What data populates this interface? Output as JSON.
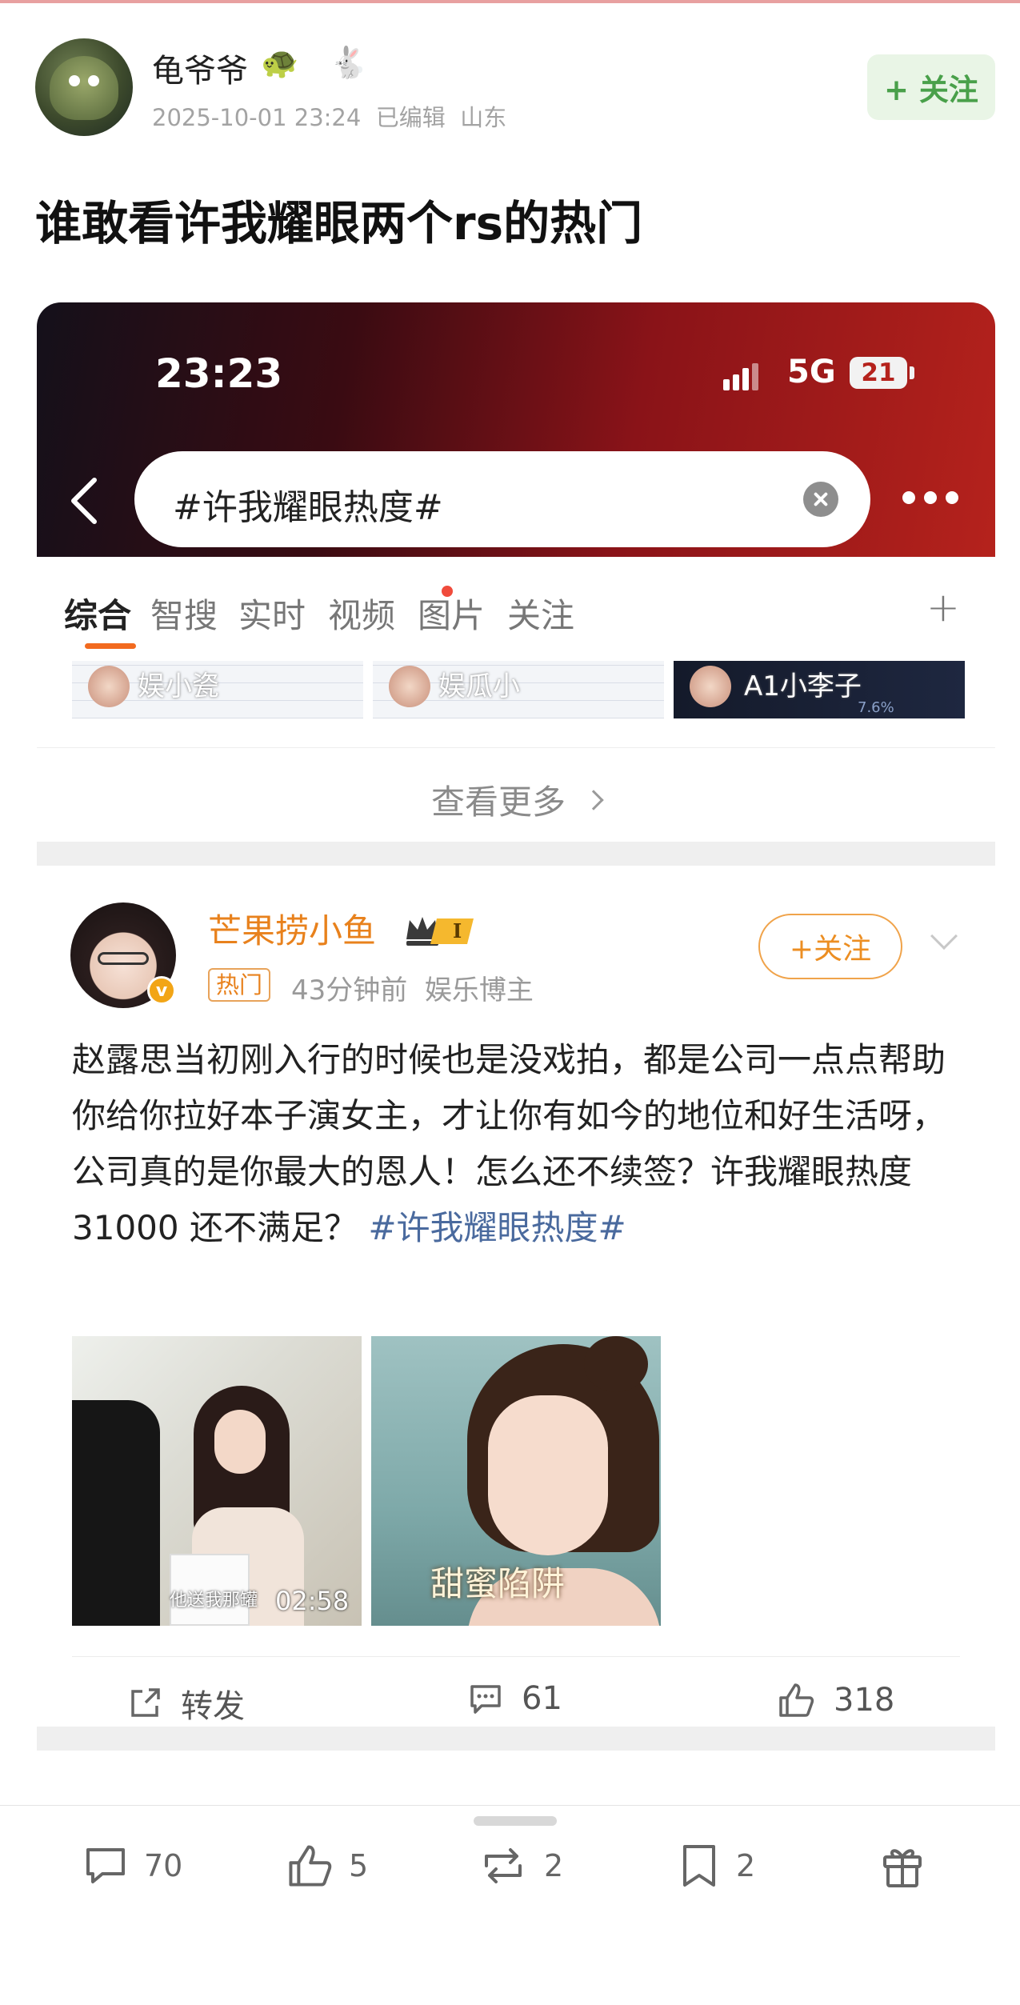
{
  "post": {
    "user_name": "龟爷爷",
    "name_emojis": [
      "🐢",
      "🐇"
    ],
    "timestamp": "2025-10-01 23:24",
    "edited": "已编辑",
    "location": "山东",
    "follow_label": "+ 关注",
    "title": "谁敢看许我耀眼两个rs的热门"
  },
  "screenshot": {
    "status_time": "23:23",
    "network": "5G",
    "battery": "21",
    "search_query": "#许我耀眼热度#",
    "tabs": [
      {
        "label": "综合",
        "active": true
      },
      {
        "label": "智搜"
      },
      {
        "label": "实时",
        "dot": true
      },
      {
        "label": "视频"
      },
      {
        "label": "图片"
      },
      {
        "label": "关注"
      }
    ],
    "tab_add": "+",
    "thumbnails": [
      {
        "label": "娱小瓷"
      },
      {
        "label": "娱瓜小"
      },
      {
        "label": "A1小李子",
        "stat": "7.6%"
      }
    ],
    "see_more": "查看更多",
    "card": {
      "author": "芒果捞小鱼",
      "level": "I",
      "hot_tag": "热门",
      "time": "43分钟前",
      "role": "娱乐博主",
      "follow_label": "+关注",
      "text": "赵露思当初刚入行的时候也是没戏拍，都是公司一点点帮助你给你拉好本子演女主，才让你有如今的地位和好生活呀，公司真的是你最大的恩人！怎么还不续签？许我耀眼热度31000  还不满足？ ",
      "hashtag": "#许我耀眼热度#",
      "video_subtitle": "他送我那罐",
      "video_duration": "02:58",
      "image_caption": "甜蜜陷阱",
      "repost_label": "转发",
      "comments": "61",
      "likes": "318"
    }
  },
  "toolbar": {
    "comments": "70",
    "likes": "5",
    "reposts": "2",
    "favorites": "2"
  },
  "colors": {
    "follow_green": "#49a04a",
    "accent_orange": "#f26a1f",
    "hashtag_blue": "#4a6a9e",
    "status_red": "#b5221c"
  }
}
